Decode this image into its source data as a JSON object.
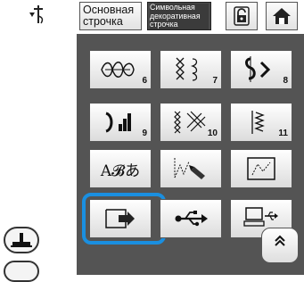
{
  "header": {
    "basic_stitch_label": "Основная строчка",
    "char_stitch_label_1": "Символьная",
    "char_stitch_label_2": "декоративная",
    "char_stitch_label_3": "строчка"
  },
  "icons": {
    "needle": "needle-position-icon",
    "lock": "lock-icon",
    "home": "home-icon",
    "presser_foot": "presser-foot-icon",
    "scroll": "chevron-up-icon"
  },
  "stitch_tiles": [
    {
      "number": "6"
    },
    {
      "number": "7"
    },
    {
      "number": "8"
    },
    {
      "number": "9"
    },
    {
      "number": "10"
    },
    {
      "number": "11"
    }
  ],
  "font_tile": {
    "text": "A𝓑あ"
  },
  "colors": {
    "selection_ring": "#1a8fe0",
    "panel_bg": "#545454",
    "selected_category_bg": "#4a4a4a"
  }
}
